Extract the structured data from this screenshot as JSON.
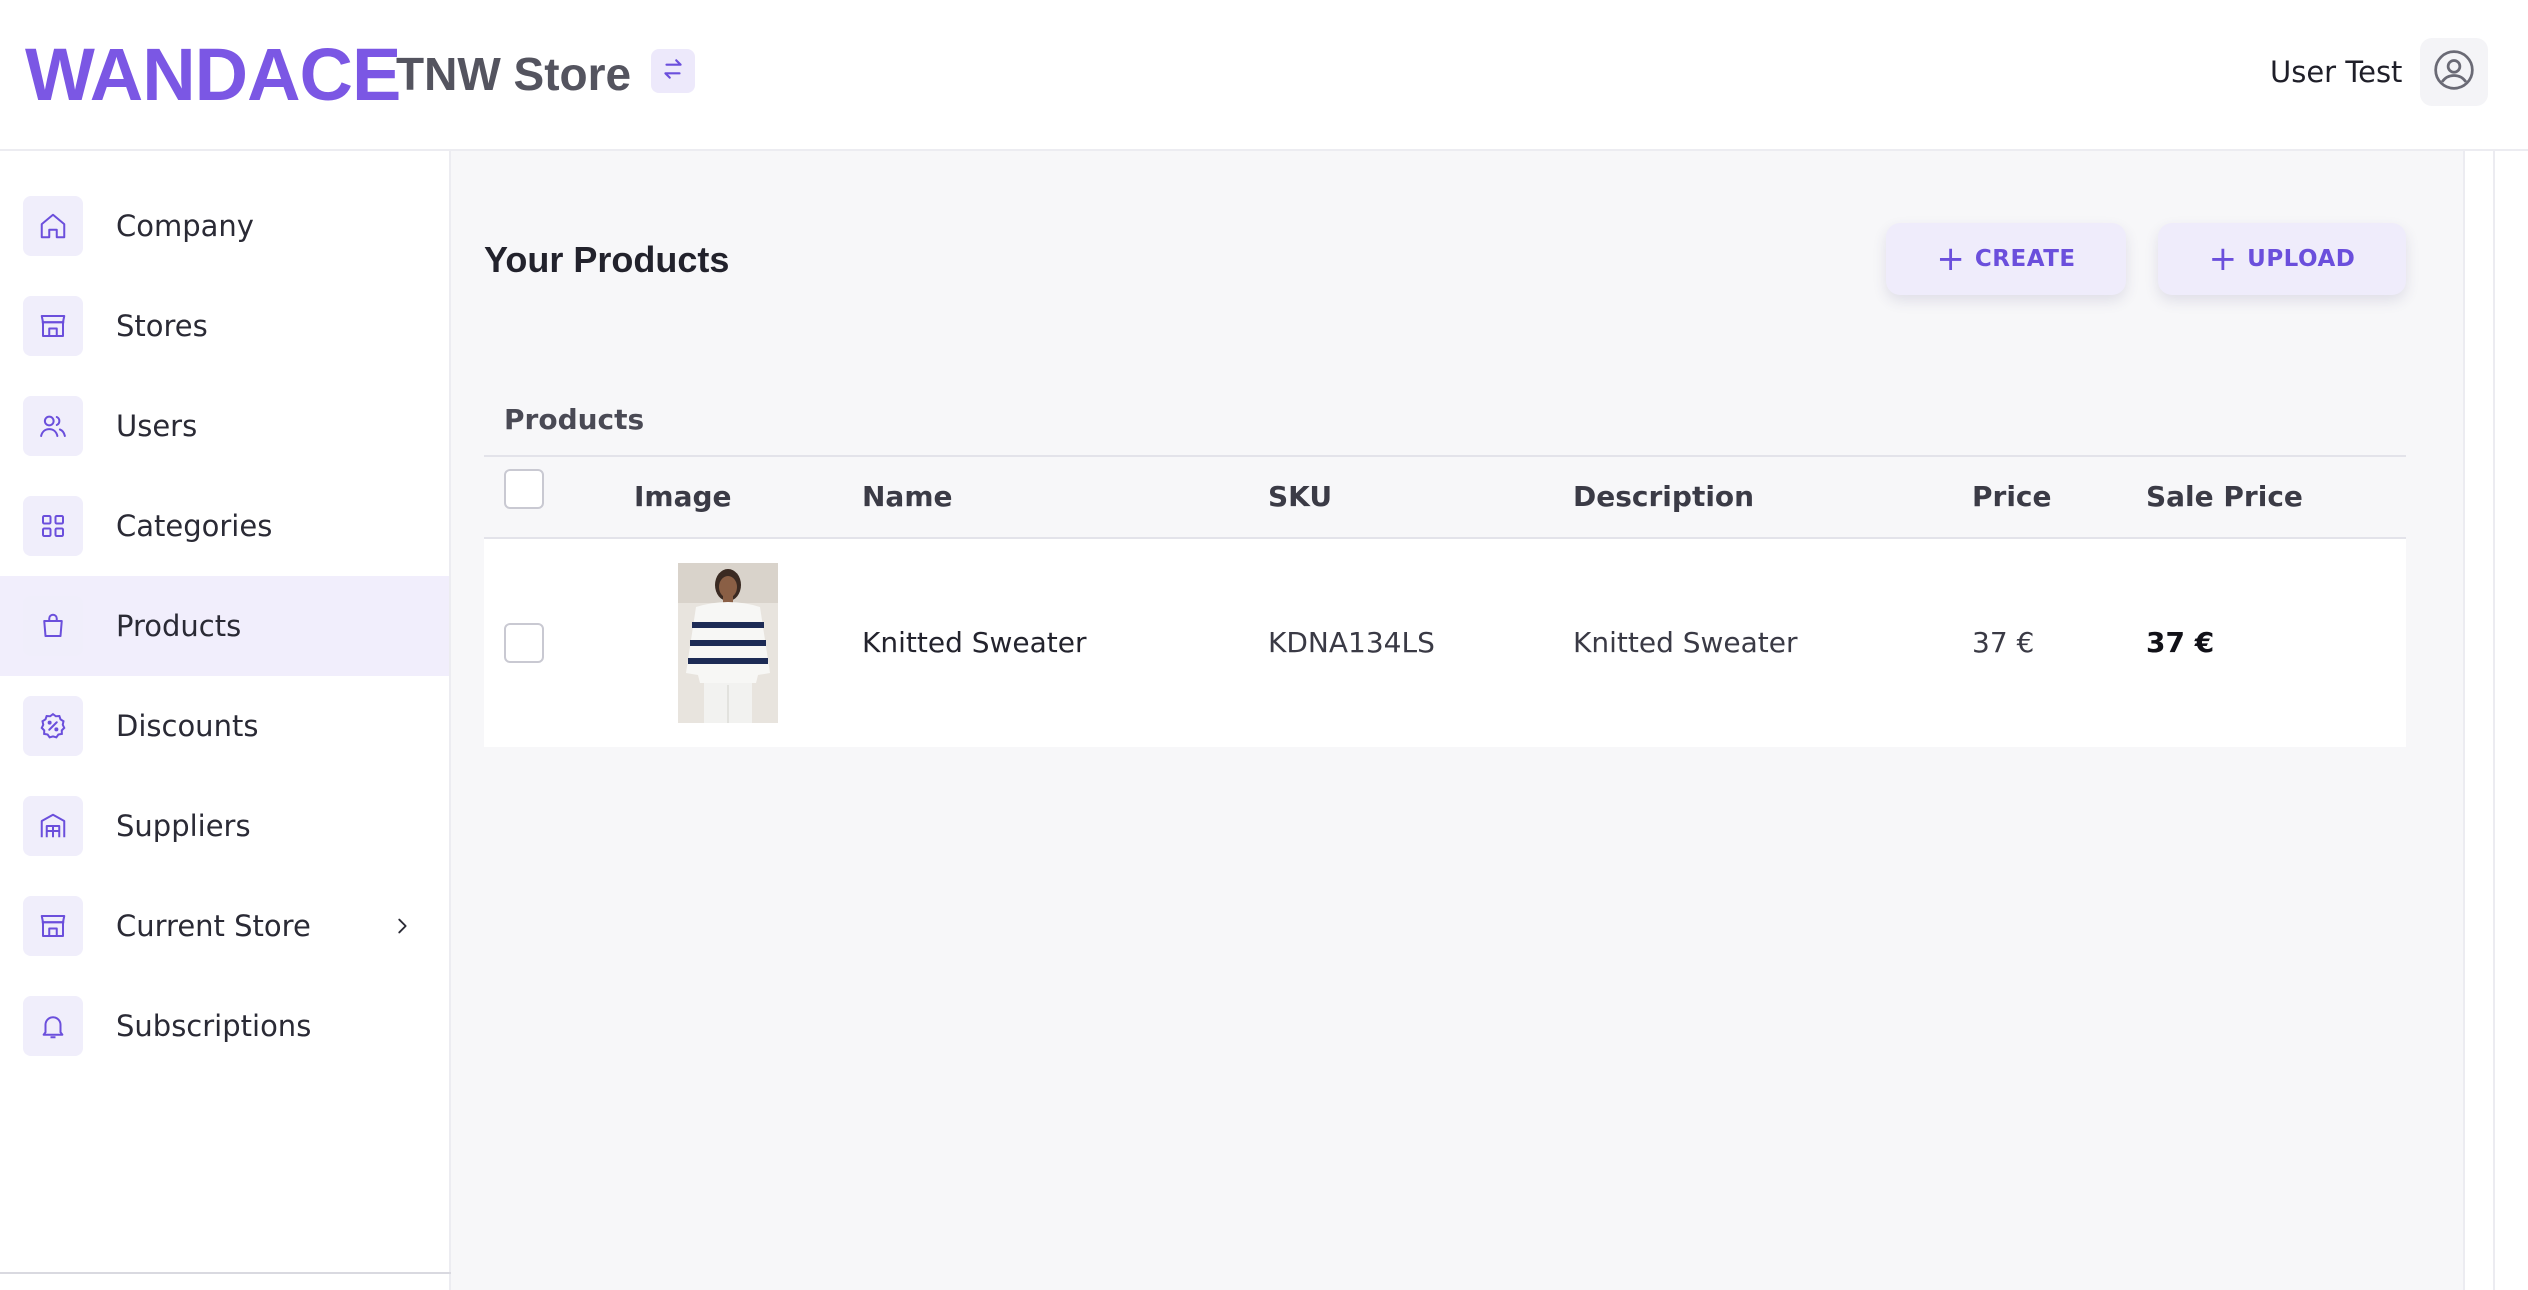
{
  "header": {
    "logo": "WANDACE",
    "store_name": "TNW Store",
    "switch_icon": "swap-arrows-icon",
    "user_name": "User Test",
    "avatar_icon": "user-circle-icon"
  },
  "sidebar": {
    "items": [
      {
        "label": "Company",
        "icon": "home-icon",
        "active": false
      },
      {
        "label": "Stores",
        "icon": "store-icon",
        "active": false
      },
      {
        "label": "Users",
        "icon": "users-icon",
        "active": false
      },
      {
        "label": "Categories",
        "icon": "grid-icon",
        "active": false
      },
      {
        "label": "Products",
        "icon": "shopping-bag-icon",
        "active": true
      },
      {
        "label": "Discounts",
        "icon": "discount-badge-icon",
        "active": false
      },
      {
        "label": "Suppliers",
        "icon": "warehouse-icon",
        "active": false
      },
      {
        "label": "Current Store",
        "icon": "store-icon",
        "active": false,
        "has_submenu": true
      },
      {
        "label": "Subscriptions",
        "icon": "bell-icon",
        "active": false
      }
    ]
  },
  "main": {
    "title": "Your Products",
    "buttons": {
      "create": "CREATE",
      "upload": "UPLOAD"
    },
    "table": {
      "caption": "Products",
      "columns": [
        "Image",
        "Name",
        "SKU",
        "Description",
        "Price",
        "Sale Price"
      ],
      "rows": [
        {
          "image": "knitted-sweater-photo",
          "name": "Knitted Sweater",
          "sku": "KDNA134LS",
          "description": "Knitted Sweater",
          "price": "37 €",
          "sale_price": "37 €"
        }
      ]
    }
  },
  "colors": {
    "brand": "#7b57e4",
    "accent_bg": "#f1eefc",
    "button_text": "#6b4fdc"
  }
}
